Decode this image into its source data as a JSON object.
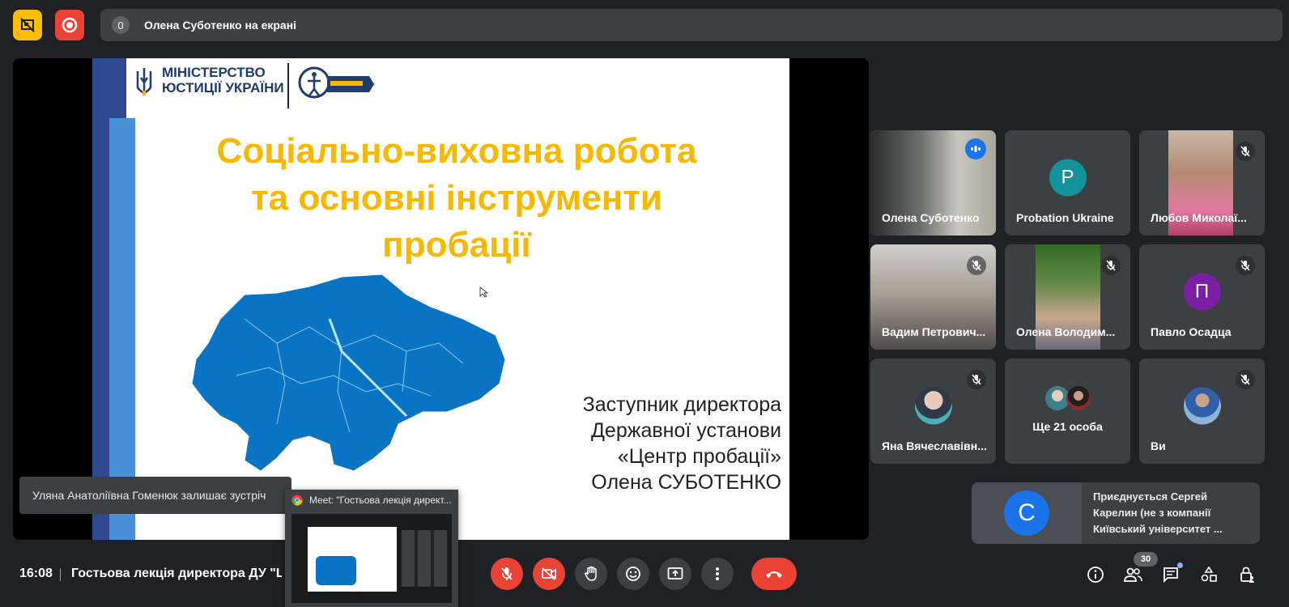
{
  "top": {
    "presenting_count": "0",
    "presenting_text": "Олена Суботенко на екрані"
  },
  "slide": {
    "logo_line1": "МІНІСТЕРСТВО",
    "logo_line2": "ЮСТИЦІЇ УКРАЇНИ",
    "title_line1": "Соціально-виховна робота",
    "title_line2": "та основні інструменти",
    "title_line3": "пробації",
    "sub_line1": "Заступник директора",
    "sub_line2": "Державної установи",
    "sub_line3": "«Центр пробації»",
    "sub_line4": "Олена СУБОТЕНКО"
  },
  "participants": [
    {
      "name": "Олена Суботенко",
      "speaking": true
    },
    {
      "name": "Probation Ukraine",
      "initial": "P",
      "color": "#12939a"
    },
    {
      "name": "Любов Миколаї...",
      "muted": true
    },
    {
      "name": "Вадим Петрович...",
      "muted": true
    },
    {
      "name": "Олена Володим...",
      "muted": true
    },
    {
      "name": "Павло Осадца",
      "initial": "П",
      "color": "#7b1fa2",
      "muted": true
    },
    {
      "name": "Яна Вячеславівн...",
      "muted": true
    },
    {
      "name": "Ще 21 особа"
    },
    {
      "name": "Ви",
      "muted": true
    }
  ],
  "notifications": {
    "leaving": "Уляна Анатоліївна Гоменюк залишає зустріч",
    "joining": "Приєднується Сергей Карелин (не з компанії Київський університет ...",
    "joining_initial": "С",
    "joining_color": "#1a73e8"
  },
  "preview": {
    "title": "Meet: \"Гостьова лекція директ..."
  },
  "bottom": {
    "time": "16:08",
    "meeting_title": "Гостьова лекція директора ДУ \"Це",
    "participants_count": "30"
  },
  "colors": {
    "accent_red": "#ea4335",
    "slide_title": "#f9b800",
    "active_speaker_border": "#8ab4f8"
  }
}
